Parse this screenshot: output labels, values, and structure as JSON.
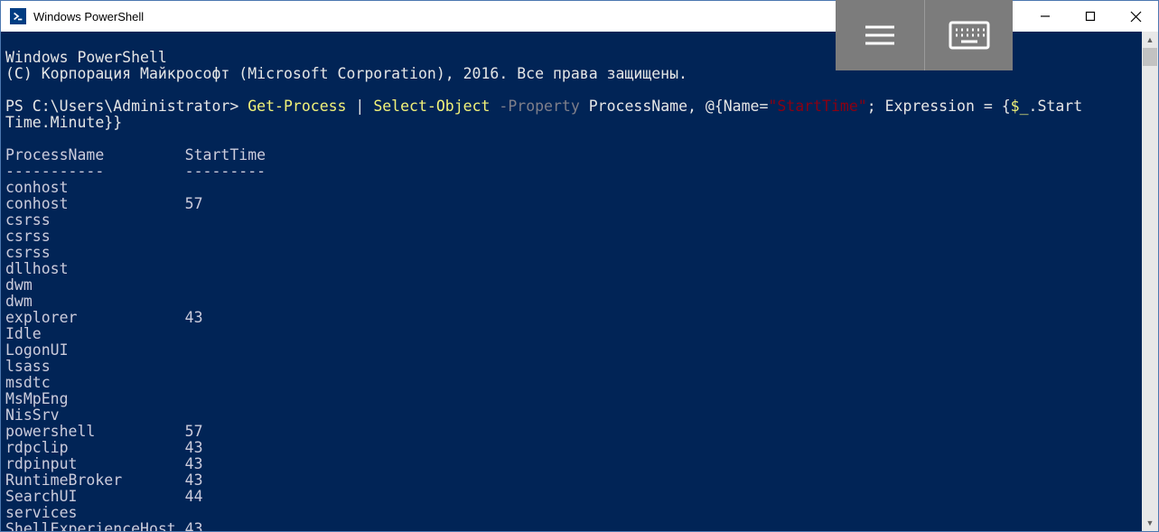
{
  "window": {
    "title": "Windows PowerShell"
  },
  "terminal": {
    "header_line1": "Windows PowerShell",
    "header_line2": "(C) Корпорация Майкрософт (Microsoft Corporation), 2016. Все права защищены.",
    "prompt": "PS C:\\Users\\Administrator> ",
    "cmd": {
      "getprocess": "Get-Process",
      "pipe": " | ",
      "selectobject": "Select-Object",
      "space1": " ",
      "property_param": "-Property",
      "space2": " ",
      "args_part1": "ProcessName, @{Name=",
      "starttime_str": "\"StartTime\"",
      "args_part2": "; Expression = {",
      "dollar_underscore": "$_",
      "args_part3": ".Start",
      "line2": "Time.Minute}}"
    },
    "columns": {
      "name": "ProcessName",
      "start": "StartTime",
      "name_sep": "-----------",
      "start_sep": "---------"
    },
    "rows": [
      {
        "name": "conhost",
        "start": ""
      },
      {
        "name": "conhost",
        "start": "57"
      },
      {
        "name": "csrss",
        "start": ""
      },
      {
        "name": "csrss",
        "start": ""
      },
      {
        "name": "csrss",
        "start": ""
      },
      {
        "name": "dllhost",
        "start": ""
      },
      {
        "name": "dwm",
        "start": ""
      },
      {
        "name": "dwm",
        "start": ""
      },
      {
        "name": "explorer",
        "start": "43"
      },
      {
        "name": "Idle",
        "start": ""
      },
      {
        "name": "LogonUI",
        "start": ""
      },
      {
        "name": "lsass",
        "start": ""
      },
      {
        "name": "msdtc",
        "start": ""
      },
      {
        "name": "MsMpEng",
        "start": ""
      },
      {
        "name": "NisSrv",
        "start": ""
      },
      {
        "name": "powershell",
        "start": "57"
      },
      {
        "name": "rdpclip",
        "start": "43"
      },
      {
        "name": "rdpinput",
        "start": "43"
      },
      {
        "name": "RuntimeBroker",
        "start": "43"
      },
      {
        "name": "SearchUI",
        "start": "44"
      },
      {
        "name": "services",
        "start": ""
      },
      {
        "name": "ShellExperienceHost",
        "start": "43"
      }
    ]
  }
}
